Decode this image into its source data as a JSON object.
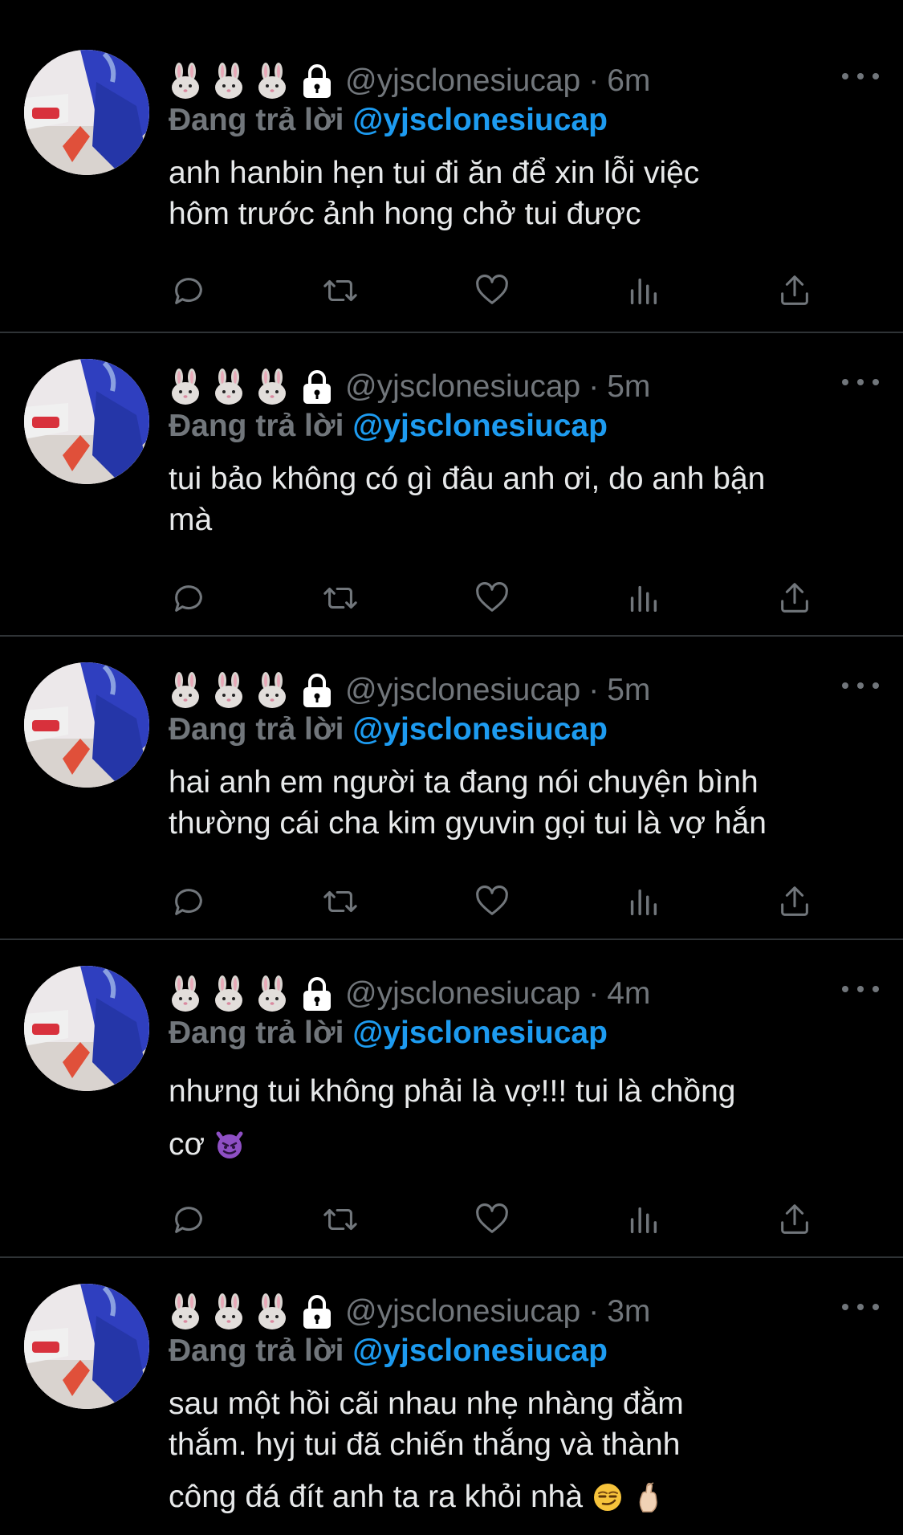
{
  "tweets": [
    {
      "handle": "@yjsclonesiucap",
      "time": "6m",
      "reply_prefix": "Đang trả lời",
      "reply_to": "@yjsclonesiucap",
      "text_l1": "anh hanbin hẹn tui đi ăn để xin lỗi việc",
      "text_l2": "hôm trước ảnh hong chở tui được",
      "text_l3": ""
    },
    {
      "handle": "@yjsclonesiucap",
      "time": "5m",
      "reply_prefix": "Đang trả lời",
      "reply_to": "@yjsclonesiucap",
      "text_l1": "tui bảo không có gì đâu anh ơi, do anh bận",
      "text_l2": "mà",
      "text_l3": ""
    },
    {
      "handle": "@yjsclonesiucap",
      "time": "5m",
      "reply_prefix": "Đang trả lời",
      "reply_to": "@yjsclonesiucap",
      "text_l1": "hai anh em người ta đang nói chuyện bình",
      "text_l2": "thường cái cha kim gyuvin gọi tui là vợ hắn",
      "text_l3": ""
    },
    {
      "handle": "@yjsclonesiucap",
      "time": "4m",
      "reply_prefix": "Đang trả lời",
      "reply_to": "@yjsclonesiucap",
      "text_l1": "nhưng tui không phải là vợ!!! tui là chồng",
      "text_l2": "cơ",
      "text_l3": ""
    },
    {
      "handle": "@yjsclonesiucap",
      "time": "3m",
      "reply_prefix": "Đang trả lời",
      "reply_to": "@yjsclonesiucap",
      "text_l1": "sau một hồi cãi nhau nhẹ nhàng đằm",
      "text_l2": "thắm. hyj tui đã chiến thắng và thành",
      "text_l3": "công đá đít anh ta ra khỏi nhà"
    }
  ],
  "separator": "·",
  "colors": {
    "background": "#000000",
    "text": "#e7e9ea",
    "muted": "#71767b",
    "link": "#1d9bf0",
    "divider": "#2f3336"
  },
  "icons": {
    "name_emoji": "rabbit-face-icon",
    "protected": "lock-icon",
    "more": "more-icon",
    "reply": "reply-icon",
    "retweet": "retweet-icon",
    "like": "heart-icon",
    "views": "views-icon",
    "share": "share-icon",
    "tweet4_emoji": "smiling-face-with-horns-icon",
    "tweet5_emoji_1": "smirking-face-icon",
    "tweet5_emoji_2": "hand-with-crossed-fingers-icon"
  }
}
